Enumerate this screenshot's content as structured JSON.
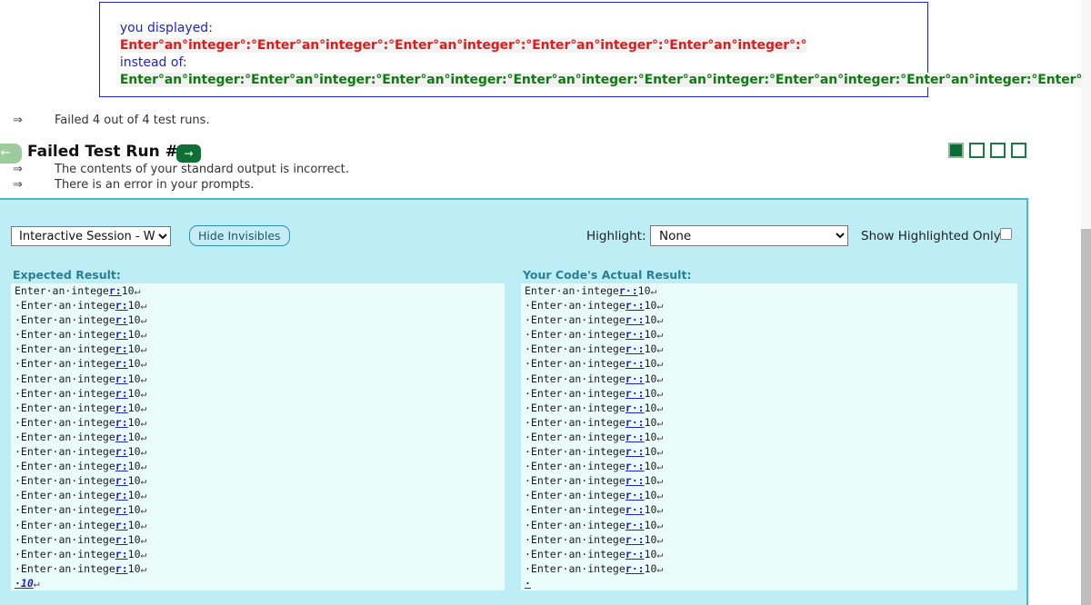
{
  "diff": {
    "you_displayed_label": "you displayed:",
    "you_displayed_text": "Enter°an°integer°:°Enter°an°integer°:°Enter°an°integer°:°Enter°an°integer°:°Enter°an°integer°:°",
    "instead_of_label": "instead of:",
    "instead_of_text": "Enter°an°integer:°Enter°an°integer:°Enter°an°integer:°Enter°an°integer:°Enter°an°integer:°Enter°an°integer:°Enter°an°integer:°Enter°an°integ",
    "colors": {
      "label": "#2222cc",
      "actual": "#e01b1b",
      "expected": "#137a13"
    }
  },
  "summary": {
    "arrow_glyph": "⇒",
    "fail_count_text": "Failed 4 out of 4 test runs."
  },
  "run": {
    "title": "Failed Test Run #1",
    "prev_label": "←",
    "next_label": "→",
    "errors": [
      "The contents of your standard output is incorrect.",
      "There is an error in your prompts."
    ],
    "pager": [
      {
        "index": 1,
        "active": true
      },
      {
        "index": 2,
        "active": false
      },
      {
        "index": 3,
        "active": false
      },
      {
        "index": 4,
        "active": false
      }
    ],
    "accent_green": "#0a6b33"
  },
  "toolbar": {
    "session_selected": "Interactive Session - W",
    "session_options": [
      "Interactive Session - W"
    ],
    "hide_invisibles_label": "Hide Invisibles",
    "highlight_label": "Highlight:",
    "highlight_selected": "None",
    "highlight_options": [
      "None"
    ],
    "show_highlighted_only_label": "Show Highlighted Only",
    "show_highlighted_only_checked": false
  },
  "compare": {
    "expected_header": "Expected Result:",
    "actual_header": "Your Code's Actual Result:",
    "line_count": 20,
    "expected": {
      "first_line": {
        "lead": "",
        "pre": "Enter·an·intege",
        "hl": "r:",
        "post": "10",
        "ret": "↵"
      },
      "repeat_line": {
        "lead": "·",
        "pre": "Enter·an·intege",
        "hl": "r:",
        "post": "10",
        "ret": "↵"
      },
      "tail_line": {
        "text": "·10",
        "ret": "↵"
      }
    },
    "actual": {
      "first_line": {
        "lead": "",
        "pre": "Enter·an·intege",
        "hl": "r·:",
        "post": "10",
        "ret": "↵"
      },
      "repeat_line": {
        "lead": "·",
        "pre": "Enter·an·intege",
        "hl": "r·:",
        "post": "10",
        "ret": "↵"
      },
      "tail_line": {
        "text": "·",
        "ret": ""
      }
    }
  }
}
